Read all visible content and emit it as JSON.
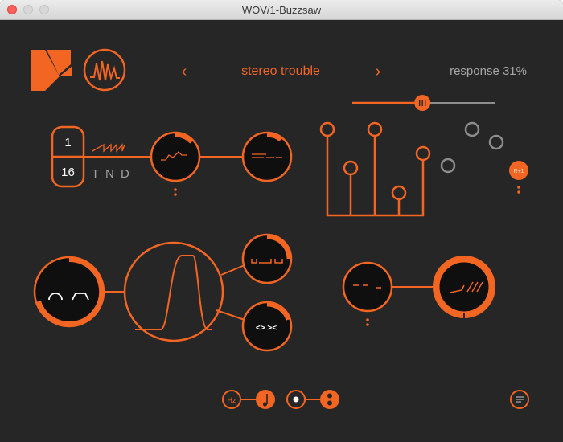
{
  "window": {
    "title": "WOV/1-Buzzsaw"
  },
  "preset": {
    "prev": "‹",
    "name": "stereo trouble",
    "next": "›"
  },
  "response": {
    "label": "response 31%",
    "value": 31
  },
  "rate": {
    "numerator": "1",
    "denominator": "16",
    "modes": "T N D"
  },
  "random_button": {
    "label": "R+1"
  },
  "colors": {
    "accent": "#f26522",
    "background": "#262626",
    "inactive": "#8c8c8c"
  },
  "icons": {
    "logo": "k-logo-icon",
    "waveform": "waveform-icon",
    "menu": "menu-lines-icon",
    "hz": "Hz",
    "note": "note-icon"
  }
}
